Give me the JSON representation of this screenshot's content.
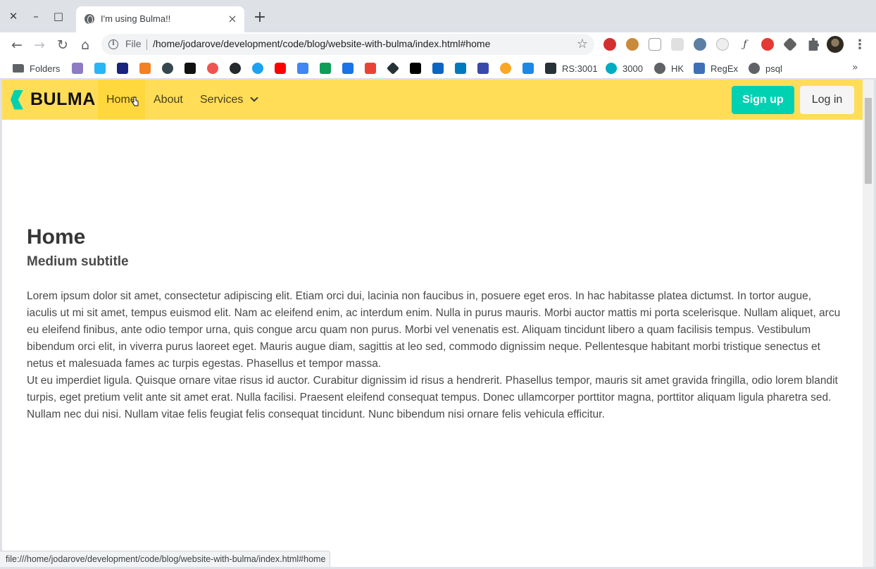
{
  "browser": {
    "tab_title": "I'm using Bulma!!",
    "omnibox_scheme": "File",
    "url": "/home/jodarove/development/code/blog/website-with-bulma/index.html#home",
    "status_url": "file:///home/jodarove/development/code/blog/website-with-bulma/index.html#home",
    "bookmarks": {
      "folders": "Folders",
      "rs": "RS:3001",
      "port": "3000",
      "hk": "HK",
      "regex": "RegEx",
      "psql": "psql"
    }
  },
  "page": {
    "brand": "BULMA",
    "nav": {
      "home": "Home",
      "about": "About",
      "services": "Services"
    },
    "buttons": {
      "signup": "Sign up",
      "login": "Log in"
    },
    "hero": {
      "title": "Home",
      "subtitle": "Medium subtitle"
    },
    "paragraph1": "Lorem ipsum dolor sit amet, consectetur adipiscing elit. Etiam orci dui, lacinia non faucibus in, posuere eget eros. In hac habitasse platea dictumst. In tortor augue, iaculis ut mi sit amet, tempus euismod elit. Nam ac eleifend enim, ac interdum enim. Nulla in purus mauris. Morbi auctor mattis mi porta scelerisque. Nullam aliquet, arcu eu eleifend finibus, ante odio tempor urna, quis congue arcu quam non purus. Morbi vel venenatis est. Aliquam tincidunt libero a quam facilisis tempus. Vestibulum bibendum orci elit, in viverra purus laoreet eget. Mauris augue diam, sagittis at leo sed, commodo dignissim neque. Pellentesque habitant morbi tristique senectus et netus et malesuada fames ac turpis egestas. Phasellus et tempor massa.",
    "paragraph2": "Ut eu imperdiet ligula. Quisque ornare vitae risus id auctor. Curabitur dignissim id risus a hendrerit. Phasellus tempor, mauris sit amet gravida fringilla, odio lorem blandit turpis, eget pretium velit ante sit amet erat. Nulla facilisi. Praesent eleifend consequat tempus. Donec ullamcorper porttitor magna, porttitor aliquam ligula pharetra sed. Nullam nec dui nisi. Nullam vitae felis feugiat felis consequat tincidunt. Nunc bibendum nisi ornare felis vehicula efficitur."
  },
  "colors": {
    "navbar": "#ffdd57",
    "primary": "#00d1b2",
    "text": "#4a4a4a",
    "title": "#363636"
  }
}
